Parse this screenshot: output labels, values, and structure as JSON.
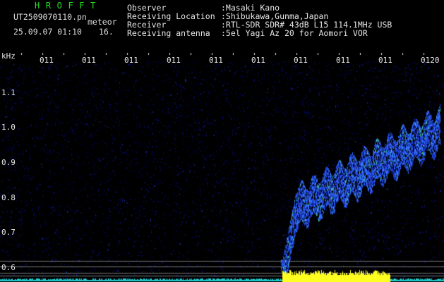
{
  "header": {
    "brand": "HROFFT",
    "filename": "UT2509070110.pn",
    "mode": "meteor",
    "datetime": "25.09.07 01:10",
    "slot": "16.",
    "rows": [
      {
        "label": "Observer",
        "value": ":Masaki Kano"
      },
      {
        "label": "Receiving Location",
        "value": ":Shibukawa,Gunma,Japan"
      },
      {
        "label": "Receiver",
        "value": ":RTL-SDR SDR# 43dB L15 114.1MHz USB"
      },
      {
        "label": "Receiving antenna",
        "value": ":5el Yagi Az 20 for Aomori VOR"
      }
    ]
  },
  "axes": {
    "y_unit": "kHz",
    "y_ticks": [
      "1.1",
      "1.0",
      "0.9",
      "0.8",
      "0.7",
      "0.6"
    ],
    "x_ticks": [
      "011",
      "011",
      "011",
      "011",
      "011",
      "011",
      "011",
      "011",
      "011",
      "0120"
    ]
  },
  "colors": {
    "background": "#000000",
    "noise": "#0a0a60",
    "echo": "#3070ff",
    "echo_hot": "#40c0a0",
    "power": "#ffff20",
    "baseline": "#20d0d0",
    "brand": "#22dd22",
    "text": "#e6e6e6"
  }
}
